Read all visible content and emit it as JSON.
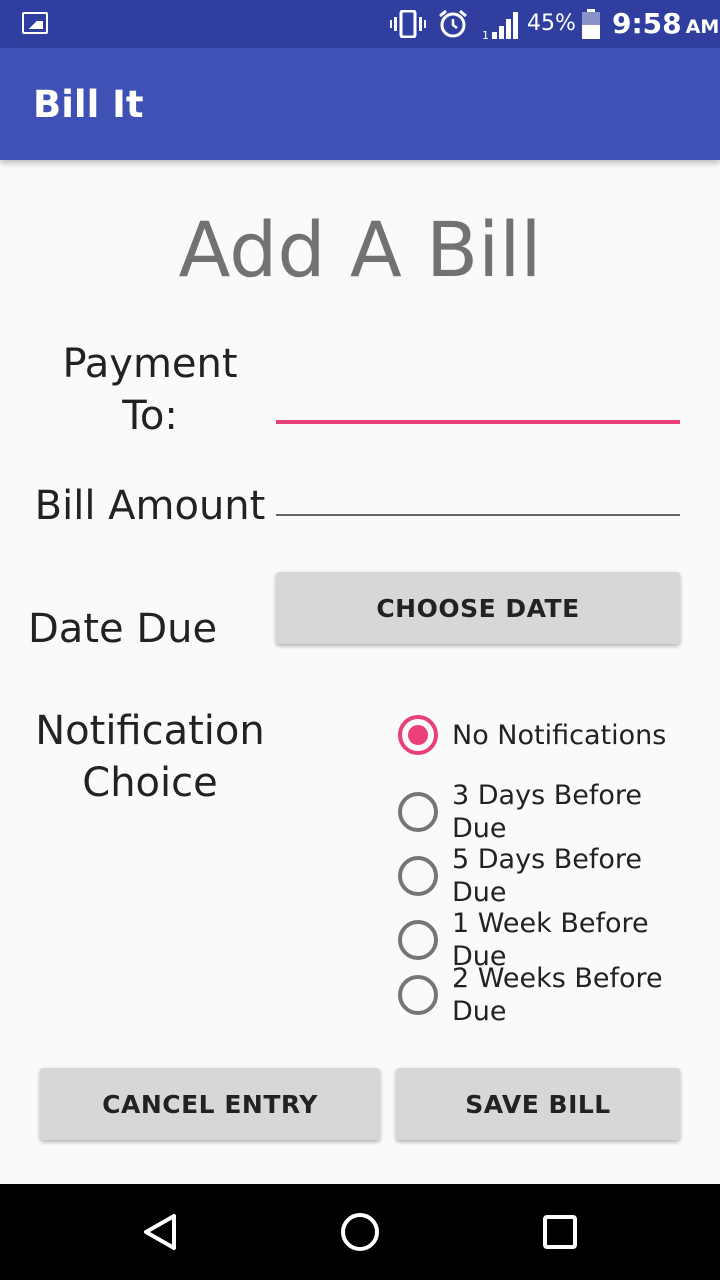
{
  "status_bar": {
    "battery_percent": "45%",
    "time": "9:58",
    "ampm": "AM",
    "icons": [
      "image-notification-icon",
      "vibrate-icon",
      "alarm-icon",
      "signal-icon",
      "battery-icon"
    ]
  },
  "app_bar": {
    "title": "Bill It",
    "color": "#3f51b5",
    "status_color": "#303f9f"
  },
  "form": {
    "title": "Add A Bill",
    "payment_label": "Payment To:",
    "payment_value": "",
    "amount_label": "Bill Amount",
    "amount_value": "",
    "date_label": "Date Due",
    "choose_date_label": "CHOOSE DATE",
    "notification_label": "Notification Choice",
    "notification_options": [
      {
        "label": "No Notifications",
        "checked": true
      },
      {
        "label": "3 Days Before Due",
        "checked": false
      },
      {
        "label": "5 Days Before Due",
        "checked": false
      },
      {
        "label": "1 Week Before Due",
        "checked": false
      },
      {
        "label": "2 Weeks Before Due",
        "checked": false
      }
    ],
    "accent_color": "#e9407a"
  },
  "actions": {
    "cancel_label": "CANCEL ENTRY",
    "save_label": "SAVE BILL"
  },
  "nav_bar": {
    "icons": [
      "back-icon",
      "home-icon",
      "recent-apps-icon"
    ]
  }
}
